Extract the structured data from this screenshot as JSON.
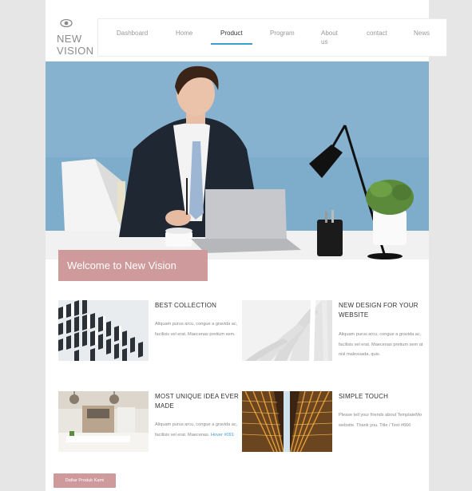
{
  "logo": {
    "line1": "NEW",
    "line2": "VISION"
  },
  "nav": [
    {
      "label": "Dashboard"
    },
    {
      "label": "Home"
    },
    {
      "label": "Product"
    },
    {
      "label": "Program"
    },
    {
      "label": "About us"
    },
    {
      "label": "contact"
    },
    {
      "label": "News"
    }
  ],
  "nav_active": "Product",
  "hero": {
    "welcome": "Welcome to New Vision"
  },
  "cards": [
    {
      "title": "BEST COLLECTION",
      "text": "Aliquam purus arcu, congue a gravida ac, facilisis vel erat. Maecenas pretium sem."
    },
    {
      "title": "NEW DESIGN FOR YOUR WEBSITE",
      "text": "Aliquam purus arcu, congue a gravida ac, facilisis vel erat. Maecenas pretium sem at nisl malesuada, quis."
    },
    {
      "title": "MOST UNIQUE IDEA EVER MADE",
      "text": "Aliquam purus arcu, congue a gravida ac, facilisis vel erat. Maecenas.",
      "link": "Hover #091"
    },
    {
      "title": "SIMPLE TOUCH",
      "text": "Please tell your friends about TemplateMo website. Thank you. Title / Text #666"
    }
  ],
  "button": {
    "label": "Daftar Produk Kami"
  },
  "colors": {
    "accent": "#cf9a9b",
    "nav_active": "#3aa0c8",
    "hero_bg": "#7aa9c8"
  },
  "icons": {
    "logo_icon": "eye-icon"
  }
}
